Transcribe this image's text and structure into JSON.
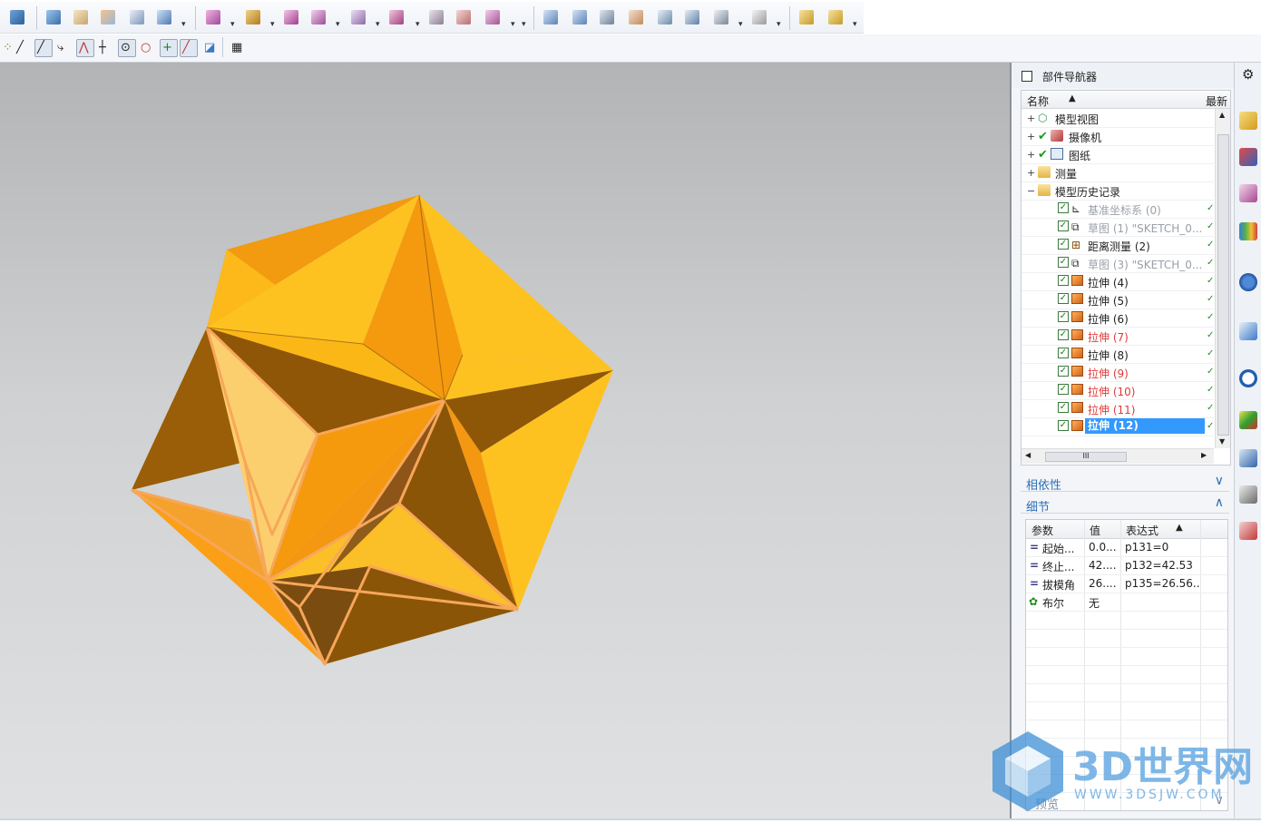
{
  "navigator": {
    "title": "部件导航器",
    "col_name": "名称",
    "col_latest": "最新",
    "items": [
      {
        "label": "模型视图",
        "style": "normal"
      },
      {
        "label": "摄像机",
        "style": "normal"
      },
      {
        "label": "图纸",
        "style": "normal"
      },
      {
        "label": "测量",
        "style": "normal"
      },
      {
        "label": "模型历史记录",
        "style": "normal"
      },
      {
        "label": "基准坐标系 (0)",
        "style": "grey"
      },
      {
        "label": "草图 (1) \"SKETCH_0...",
        "style": "grey"
      },
      {
        "label": "距离测量 (2)",
        "style": "normal"
      },
      {
        "label": "草图 (3) \"SKETCH_0...",
        "style": "grey"
      },
      {
        "label": "拉伸 (4)",
        "style": "normal"
      },
      {
        "label": "拉伸 (5)",
        "style": "normal"
      },
      {
        "label": "拉伸 (6)",
        "style": "normal"
      },
      {
        "label": "拉伸 (7)",
        "style": "red"
      },
      {
        "label": "拉伸 (8)",
        "style": "normal"
      },
      {
        "label": "拉伸 (9)",
        "style": "red"
      },
      {
        "label": "拉伸 (10)",
        "style": "red"
      },
      {
        "label": "拉伸 (11)",
        "style": "red"
      },
      {
        "label": "拉伸 (12)",
        "style": "selected"
      }
    ],
    "hscroll_glyph": "III"
  },
  "dependencies": {
    "label": "相依性",
    "chevron": "∨"
  },
  "details": {
    "label": "细节",
    "chevron": "∧",
    "headers": {
      "param": "参数",
      "value": "值",
      "expr": "表达式"
    },
    "rows": [
      {
        "param": "起始...",
        "value": "0.0...",
        "expr": "p131=0",
        "icon": "equals-icon"
      },
      {
        "param": "终止...",
        "value": "42....",
        "expr": "p132=42.53",
        "icon": "equals-icon"
      },
      {
        "param": "拔模角",
        "value": "26....",
        "expr": "p135=26.56...",
        "icon": "equals-icon"
      },
      {
        "param": "布尔",
        "value": "无",
        "expr": "",
        "icon": "boolean-icon"
      }
    ]
  },
  "preview": {
    "label": "预览"
  },
  "watermark": {
    "brand": "3D世界网",
    "url": "WWW.3DSJW.COM"
  },
  "colors": {
    "selection": "#3399ff",
    "section_text": "#2f6fb4",
    "model_light": "#fdc220",
    "model_mid": "#f59a0c",
    "model_dark": "#8a5406",
    "model_edge": "#f7a75a"
  }
}
